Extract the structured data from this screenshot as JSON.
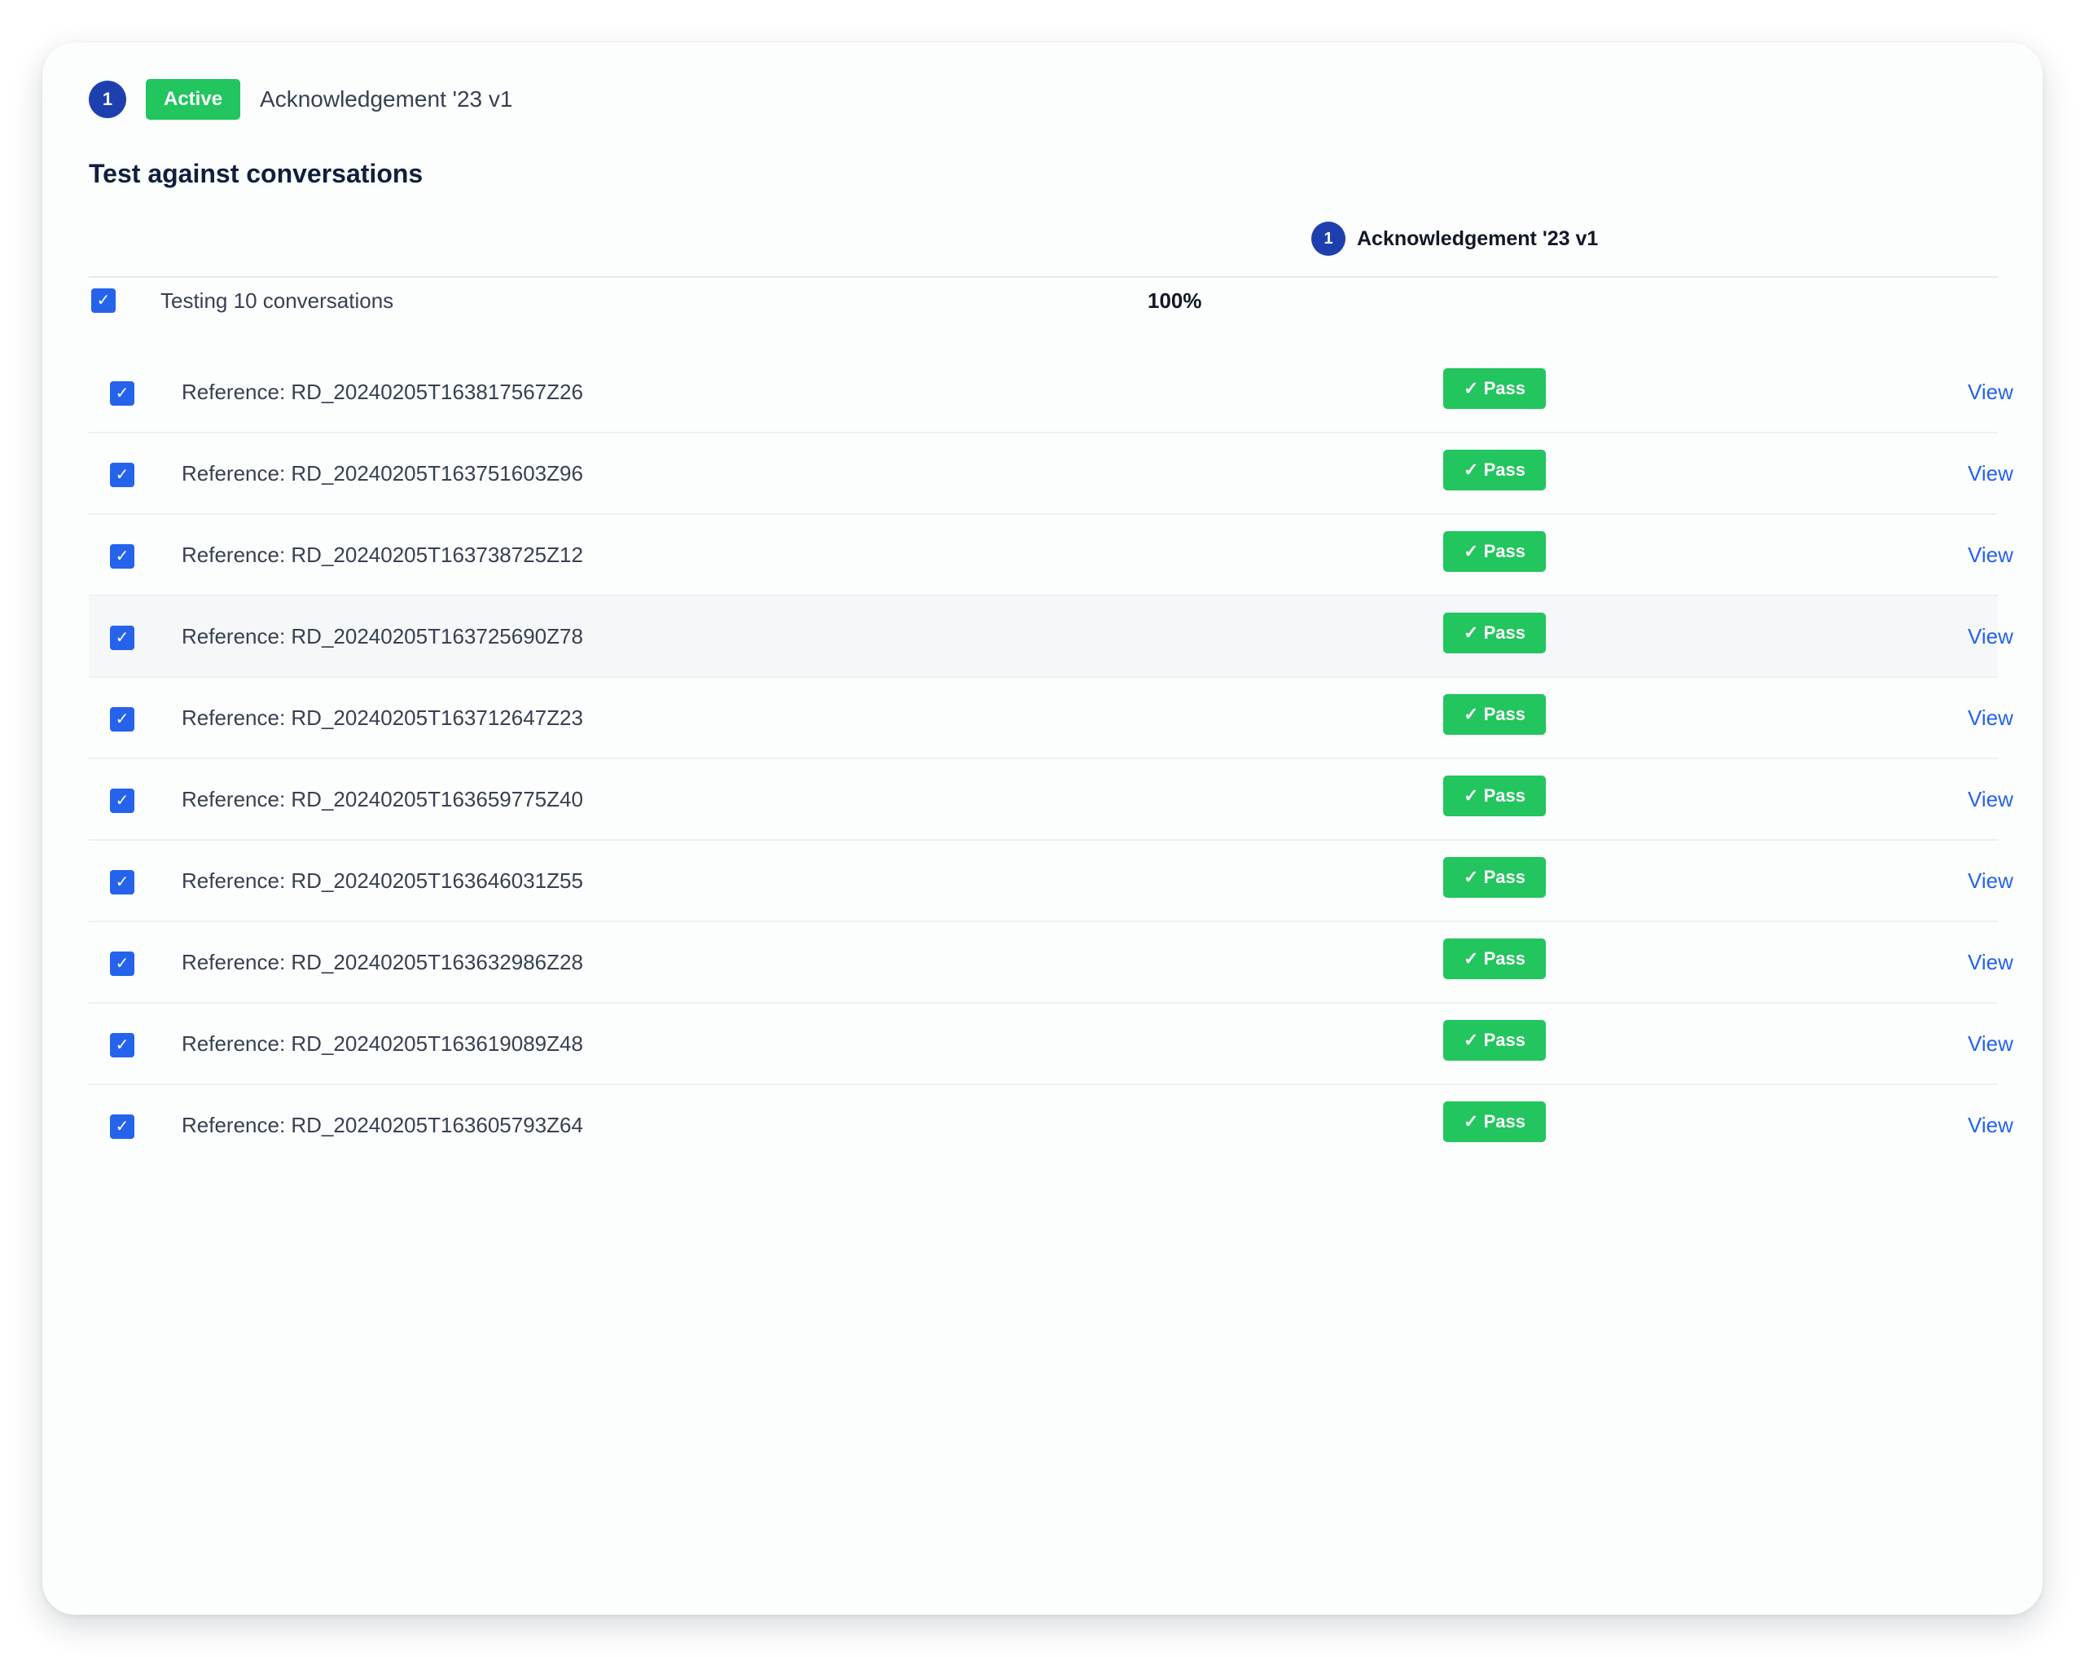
{
  "header": {
    "policy_number": "1",
    "status": "Active",
    "policy_name": "Acknowledgement '23 v1"
  },
  "section_title": "Test against conversations",
  "column": {
    "number": "1",
    "label": "Acknowledgement '23 v1"
  },
  "summary": {
    "text": "Testing 10 conversations",
    "percent": "100%",
    "checked": true
  },
  "rows": [
    {
      "reference": "Reference: RD_20240205T163817567Z26",
      "result": "✓ Pass",
      "action": "View",
      "checked": true
    },
    {
      "reference": "Reference: RD_20240205T163751603Z96",
      "result": "✓ Pass",
      "action": "View",
      "checked": true
    },
    {
      "reference": "Reference: RD_20240205T163738725Z12",
      "result": "✓ Pass",
      "action": "View",
      "checked": true
    },
    {
      "reference": "Reference: RD_20240205T163725690Z78",
      "result": "✓ Pass",
      "action": "View",
      "checked": true
    },
    {
      "reference": "Reference: RD_20240205T163712647Z23",
      "result": "✓ Pass",
      "action": "View",
      "checked": true
    },
    {
      "reference": "Reference: RD_20240205T163659775Z40",
      "result": "✓ Pass",
      "action": "View",
      "checked": true
    },
    {
      "reference": "Reference: RD_20240205T163646031Z55",
      "result": "✓ Pass",
      "action": "View",
      "checked": true
    },
    {
      "reference": "Reference: RD_20240205T163632986Z28",
      "result": "✓ Pass",
      "action": "View",
      "checked": true
    },
    {
      "reference": "Reference: RD_20240205T163619089Z48",
      "result": "✓ Pass",
      "action": "View",
      "checked": true
    },
    {
      "reference": "Reference: RD_20240205T163605793Z64",
      "result": "✓ Pass",
      "action": "View",
      "checked": true
    }
  ],
  "colors": {
    "accent_blue": "#2563eb",
    "badge_navy": "#1e40af",
    "pass_green": "#22c55e"
  },
  "icons": {
    "checkbox": "checkmark-icon"
  }
}
